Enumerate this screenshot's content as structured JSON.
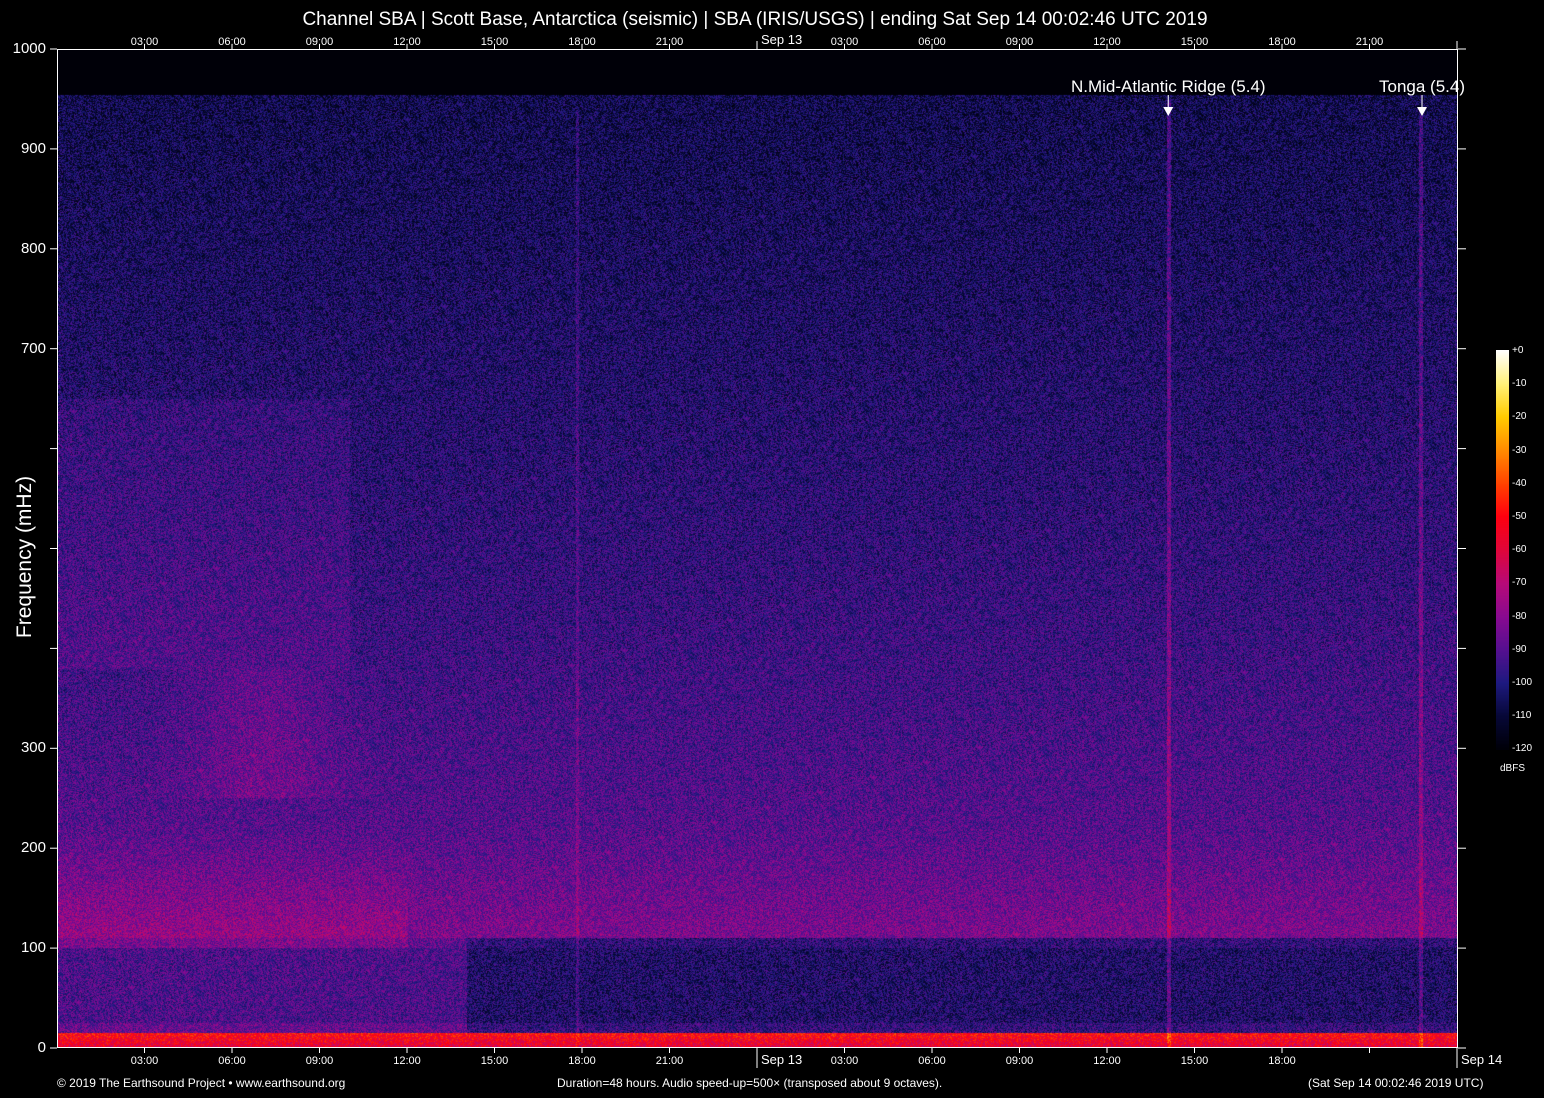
{
  "chart_data": {
    "type": "heatmap",
    "title": "Channel SBA | Scott Base, Antarctica (seismic) | SBA (IRIS/USGS) | ending Sat Sep 14 00:02:46 UTC 2019",
    "ylabel": "Frequency (mHz)",
    "ylim": [
      0,
      1000
    ],
    "y_ticks": [
      0,
      100,
      200,
      300,
      400,
      500,
      600,
      700,
      800,
      900,
      1000
    ],
    "y_tick_labels": [
      "0",
      "100",
      "200",
      "300",
      "",
      "",
      "",
      "700",
      "800",
      "900",
      "1000"
    ],
    "x_range_hours": [
      0,
      48
    ],
    "x_tick_labels_top": [
      "03:00",
      "06:00",
      "09:00",
      "12:00",
      "15:00",
      "18:00",
      "21:00",
      "Sep 13",
      "03:00",
      "06:00",
      "09:00",
      "12:00",
      "15:00",
      "18:00",
      "21:00"
    ],
    "x_tick_labels_bottom": [
      "03:00",
      "06:00",
      "09:00",
      "12:00",
      "15:00",
      "18:00",
      "21:00",
      "Sep 13",
      "03:00",
      "06:00",
      "09:00",
      "12:00",
      "15:00",
      "18:00",
      "",
      "Sep 14"
    ],
    "annotations": [
      {
        "label": "N.Mid-Atlantic Ridge (5.4)",
        "hour": 38.1
      },
      {
        "label": "Tonga (5.4)",
        "hour": 46.8
      }
    ],
    "colorbar": {
      "label": "dBFS",
      "range": [
        -120,
        0
      ],
      "tick_labels": [
        "+0",
        "-10",
        "-20",
        "-30",
        "-40",
        "-50",
        "-60",
        "-70",
        "-80",
        "-90",
        "-100",
        "-110",
        "-120"
      ],
      "colors": [
        "#ffffff",
        "#fff27a",
        "#ffcc00",
        "#ff8c00",
        "#ff4400",
        "#ff0010",
        "#e0063a",
        "#b80a78",
        "#8a0a90",
        "#561090",
        "#1e1a80",
        "#070838",
        "#000008"
      ]
    }
  },
  "footer": {
    "left": "© 2019 The Earthsound Project • www.earthsound.org",
    "center": "Duration=48 hours. Audio speed-up=500× (transposed about 9 octaves).",
    "right": "(Sat Sep 14 00:02:46 2019 UTC)"
  }
}
